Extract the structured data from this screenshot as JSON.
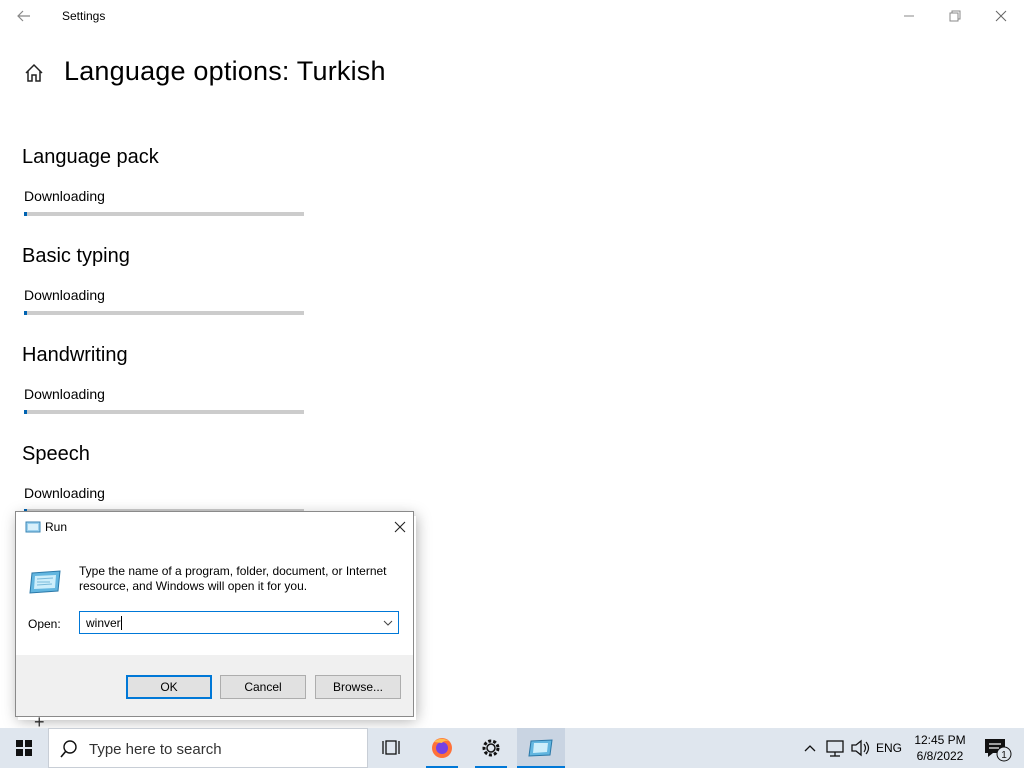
{
  "window": {
    "title": "Settings",
    "page_title": "Language options: Turkish"
  },
  "sections": [
    {
      "title": "Language pack",
      "status": "Downloading",
      "progress": 0.01
    },
    {
      "title": "Basic typing",
      "status": "Downloading",
      "progress": 0.01
    },
    {
      "title": "Handwriting",
      "status": "Downloading",
      "progress": 0.01
    },
    {
      "title": "Speech",
      "status": "Downloading",
      "progress": 0.01
    }
  ],
  "run_dialog": {
    "title": "Run",
    "description": "Type the name of a program, folder, document, or Internet resource, and Windows will open it for you.",
    "open_label": "Open:",
    "open_value": "winver",
    "ok_label": "OK",
    "cancel_label": "Cancel",
    "browse_label": "Browse..."
  },
  "taskbar": {
    "search_placeholder": "Type here to search",
    "apps": [
      "task-view",
      "firefox",
      "settings",
      "run"
    ],
    "language": "ENG",
    "time": "12:45 PM",
    "date": "6/8/2022",
    "notification_count": "1"
  },
  "colors": {
    "accent": "#0078d7",
    "progress": "#0063b1",
    "taskbar": "#dfe6ee"
  }
}
